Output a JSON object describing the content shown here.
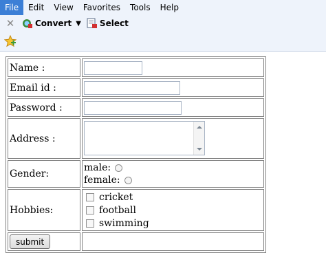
{
  "menubar": {
    "items": [
      {
        "label": "File",
        "active": true
      },
      {
        "label": "Edit"
      },
      {
        "label": "View"
      },
      {
        "label": "Favorites"
      },
      {
        "label": "Tools"
      },
      {
        "label": "Help"
      }
    ]
  },
  "toolbar": {
    "close_icon": "close-icon",
    "convert_label": "Convert",
    "select_label": "Select"
  },
  "favorites": {
    "icon": "favorites-star-icon"
  },
  "form": {
    "name_label": "Name :",
    "name_value": "",
    "email_label": "Email id :",
    "email_value": "",
    "password_label": "Password :",
    "password_value": "",
    "address_label": "Address :",
    "address_value": "",
    "gender_label": "Gender:",
    "gender_options": [
      "male:",
      "female:"
    ],
    "hobbies_label": "Hobbies:",
    "hobbies": [
      "cricket",
      "football",
      "swimming"
    ],
    "submit_label": "submit"
  },
  "colors": {
    "menu_active_bg": "#3c7fd6",
    "chrome_bg": "#eef3fb",
    "table_border": "#808080"
  }
}
